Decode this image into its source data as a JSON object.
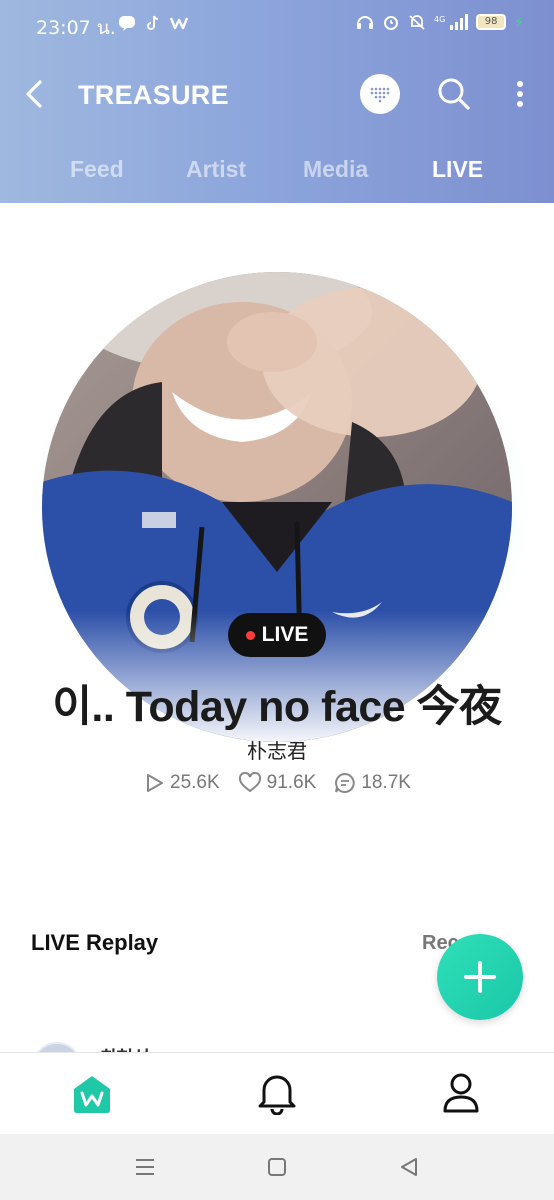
{
  "status_bar": {
    "time": "23:07 น.",
    "battery": "98",
    "network": "4G"
  },
  "header": {
    "title": "TREASURE",
    "tabs": [
      {
        "label": "Feed",
        "active": false
      },
      {
        "label": "Artist",
        "active": false
      },
      {
        "label": "Media",
        "active": false
      },
      {
        "label": "LIVE",
        "active": true
      }
    ]
  },
  "live": {
    "badge": "LIVE",
    "title": "이.. Today no face 今夜",
    "artist": "朴志君",
    "stats": {
      "plays": "25.6K",
      "likes": "91.6K",
      "comments": "18.7K"
    }
  },
  "replay": {
    "heading": "LIVE Replay",
    "sort_label": "Rec",
    "first_item_name": "최현석"
  },
  "colors": {
    "header_start": "#9fb8df",
    "header_end": "#7d8fd0",
    "accent": "#1bc7a8",
    "live_dot": "#ff3b3b"
  }
}
